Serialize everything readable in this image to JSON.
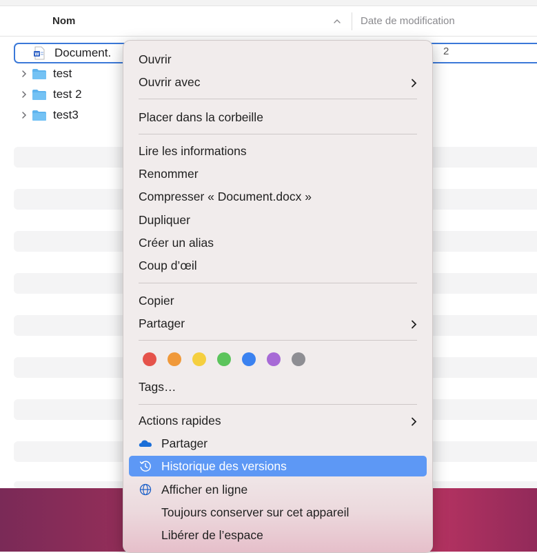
{
  "header": {
    "name_col": "Nom",
    "date_col": "Date de modification"
  },
  "files": [
    {
      "name": "Document.",
      "type": "word-doc",
      "date_fragment": "2"
    },
    {
      "name": "test",
      "type": "folder"
    },
    {
      "name": "test 2",
      "type": "folder"
    },
    {
      "name": "test3",
      "type": "folder"
    }
  ],
  "menu": {
    "open": "Ouvrir",
    "open_with": "Ouvrir avec",
    "trash": "Placer dans la corbeille",
    "get_info": "Lire les informations",
    "rename": "Renommer",
    "compress": "Compresser « Document.docx »",
    "duplicate": "Dupliquer",
    "make_alias": "Créer un alias",
    "quick_look": "Coup d’œil",
    "copy": "Copier",
    "share": "Partager",
    "tags": "Tags…",
    "quick_actions": "Actions rapides",
    "onedrive_share": "Partager",
    "version_history": "Historique des versions",
    "view_online": "Afficher en ligne",
    "always_keep": "Toujours conserver sur cet appareil",
    "free_space": "Libérer de l’espace"
  },
  "tag_colors": [
    "#e5534b",
    "#f0993a",
    "#f5cf3f",
    "#5cc45c",
    "#3b82f0",
    "#a76ad6",
    "#8e8e93"
  ],
  "colors": {
    "selection": "#3a78d8",
    "highlight": "#5d98f5",
    "folder": "#5fb4ee"
  }
}
